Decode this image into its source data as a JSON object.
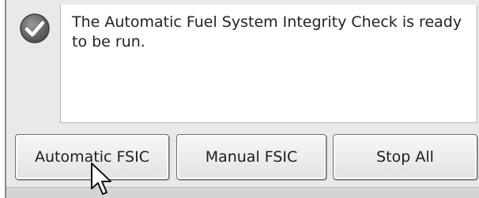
{
  "status": {
    "icon": "checkmark-icon",
    "message": "The Automatic Fuel System Integrity Check is ready to be run."
  },
  "buttons": {
    "automatic_label": "Automatic FSIC",
    "manual_label": "Manual FSIC",
    "stop_label": "Stop All"
  },
  "colors": {
    "check_badge": "#6c6c6c",
    "panel_background": "#e9e9e9",
    "message_background": "#ffffff"
  }
}
